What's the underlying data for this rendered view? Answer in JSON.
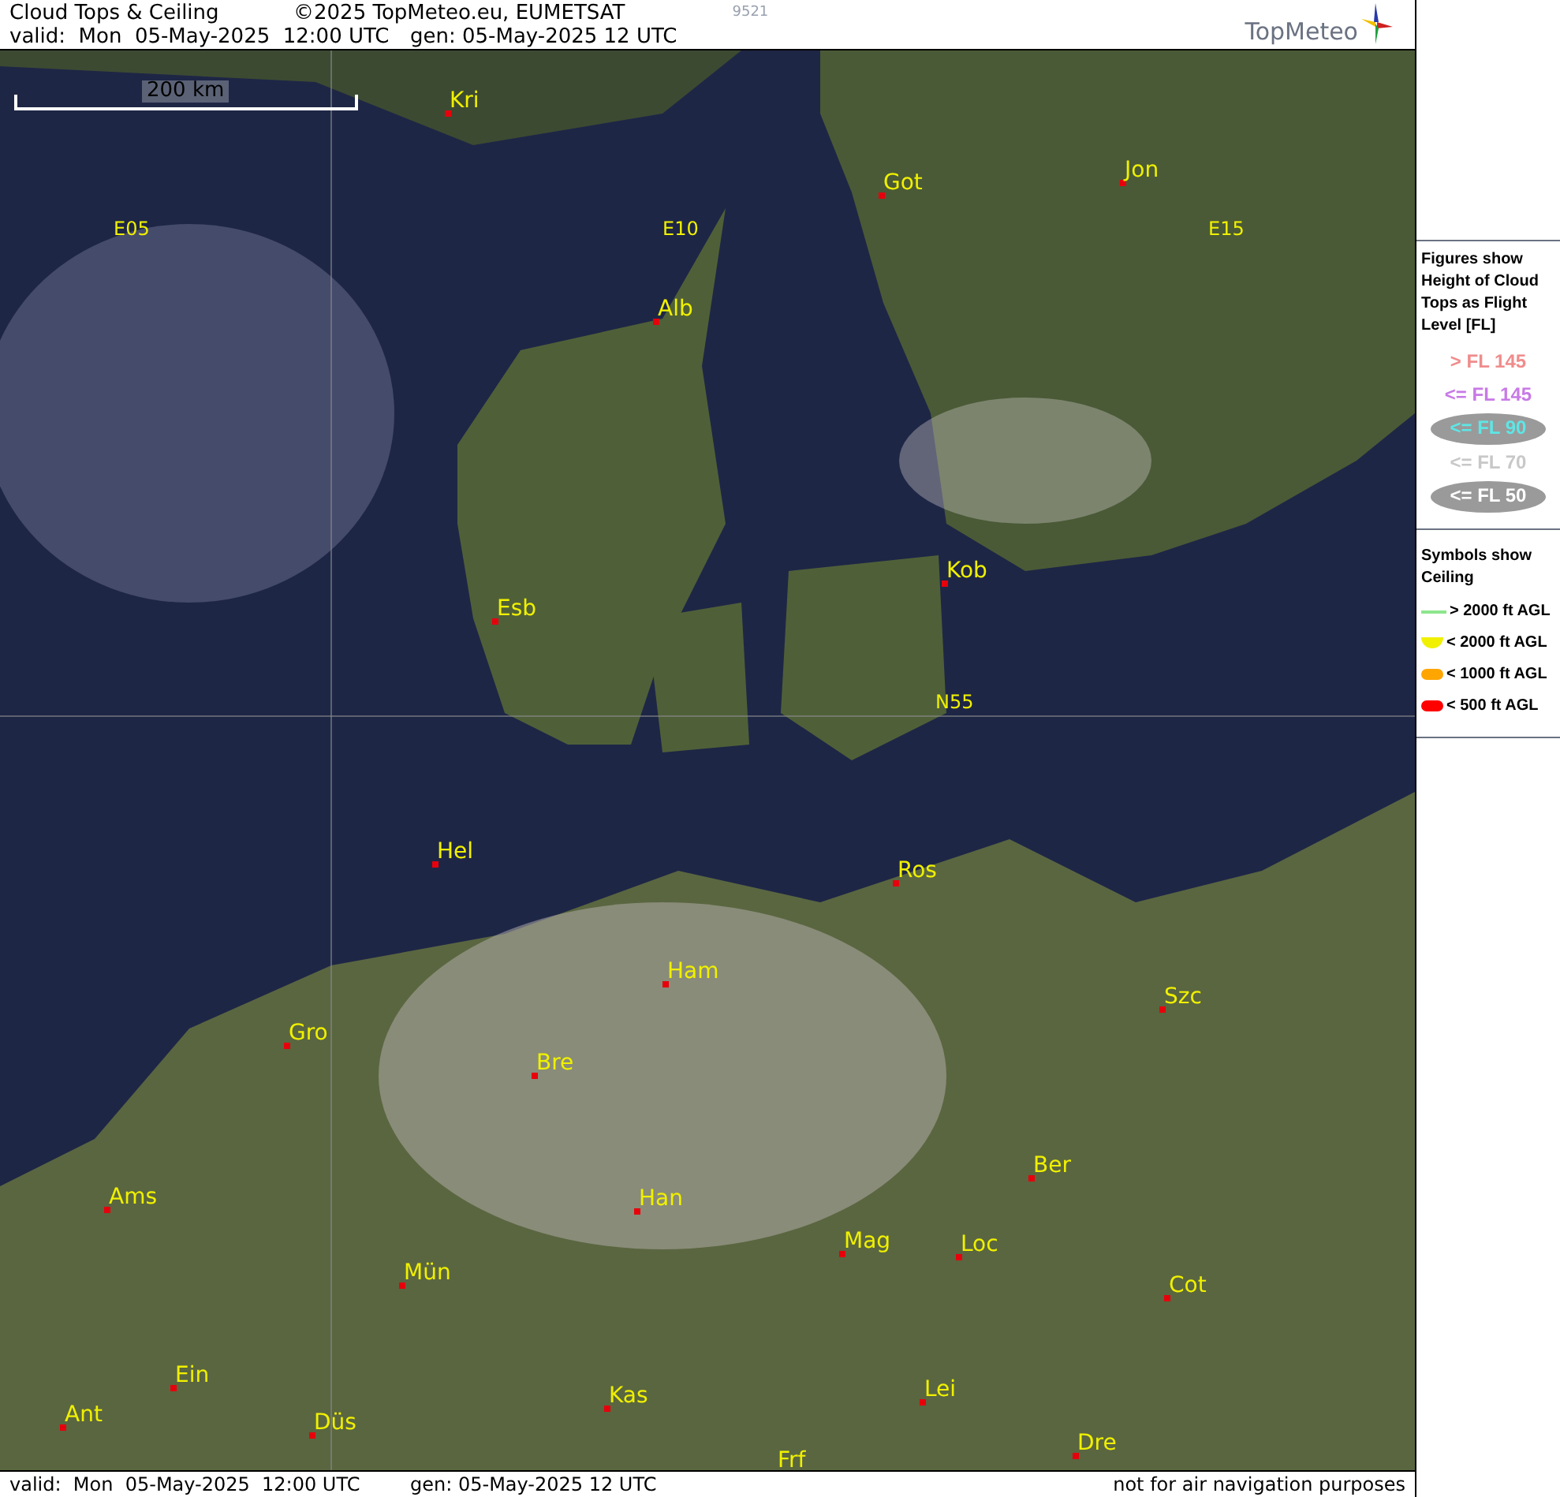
{
  "header": {
    "title": "Cloud Tops & Ceiling",
    "copyright": "©2025 TopMeteo.eu, EUMETSAT",
    "code": "9521",
    "valid": "valid:  Mon  05-May-2025  12:00 UTC",
    "generated": "gen: 05-May-2025 12 UTC",
    "logo": "TopMeteo"
  },
  "map": {
    "scale": "200 km",
    "cities": [
      {
        "name": "Kri"
      },
      {
        "name": "Got"
      },
      {
        "name": "Jon"
      },
      {
        "name": "Alb"
      },
      {
        "name": "Esb"
      },
      {
        "name": "Kob"
      },
      {
        "name": "Hel"
      },
      {
        "name": "Ros"
      },
      {
        "name": "Ham"
      },
      {
        "name": "Szc"
      },
      {
        "name": "Gro"
      },
      {
        "name": "Bre"
      },
      {
        "name": "Ber"
      },
      {
        "name": "Ams"
      },
      {
        "name": "Han"
      },
      {
        "name": "Mag"
      },
      {
        "name": "Loc"
      },
      {
        "name": "Mün"
      },
      {
        "name": "Cot"
      },
      {
        "name": "Ein"
      },
      {
        "name": "Kas"
      },
      {
        "name": "Lei"
      },
      {
        "name": "Ant"
      },
      {
        "name": "Düs"
      },
      {
        "name": "Dre"
      },
      {
        "name": "Frf"
      }
    ],
    "grid_labels": [
      "E05",
      "E10",
      "E15",
      "N55"
    ]
  },
  "legend": {
    "figures_title": "Figures show Height of Cloud Tops as Flight Level  [FL]",
    "figures": [
      {
        "label": "> FL 145",
        "color": "#f08c8c",
        "kind": "plain"
      },
      {
        "label": "<= FL 145",
        "color": "#c87ae6",
        "kind": "plain"
      },
      {
        "label": "<= FL 90",
        "color": "#5ee6e6",
        "kind": "oval"
      },
      {
        "label": "<= FL 70",
        "color": "#c8c8c8",
        "kind": "plain"
      },
      {
        "label": "<= FL 50",
        "color": "#ffffff",
        "kind": "oval"
      }
    ],
    "symbols_title": "Symbols show Ceiling",
    "symbols": [
      {
        "label": "> 2000 ft AGL",
        "color": "#8ce68c",
        "kind": "line"
      },
      {
        "label": "< 2000 ft AGL",
        "color": "#f0f000",
        "kind": "cup"
      },
      {
        "label": "< 1000 ft AGL",
        "color": "#ffa500",
        "kind": "pill"
      },
      {
        "label": "< 500 ft AGL",
        "color": "#ff0000",
        "kind": "pill"
      }
    ]
  },
  "footer": {
    "valid": "valid:  Mon  05-May-2025  12:00 UTC",
    "generated": "gen: 05-May-2025 12 UTC",
    "disclaimer": "not for air navigation purposes"
  }
}
